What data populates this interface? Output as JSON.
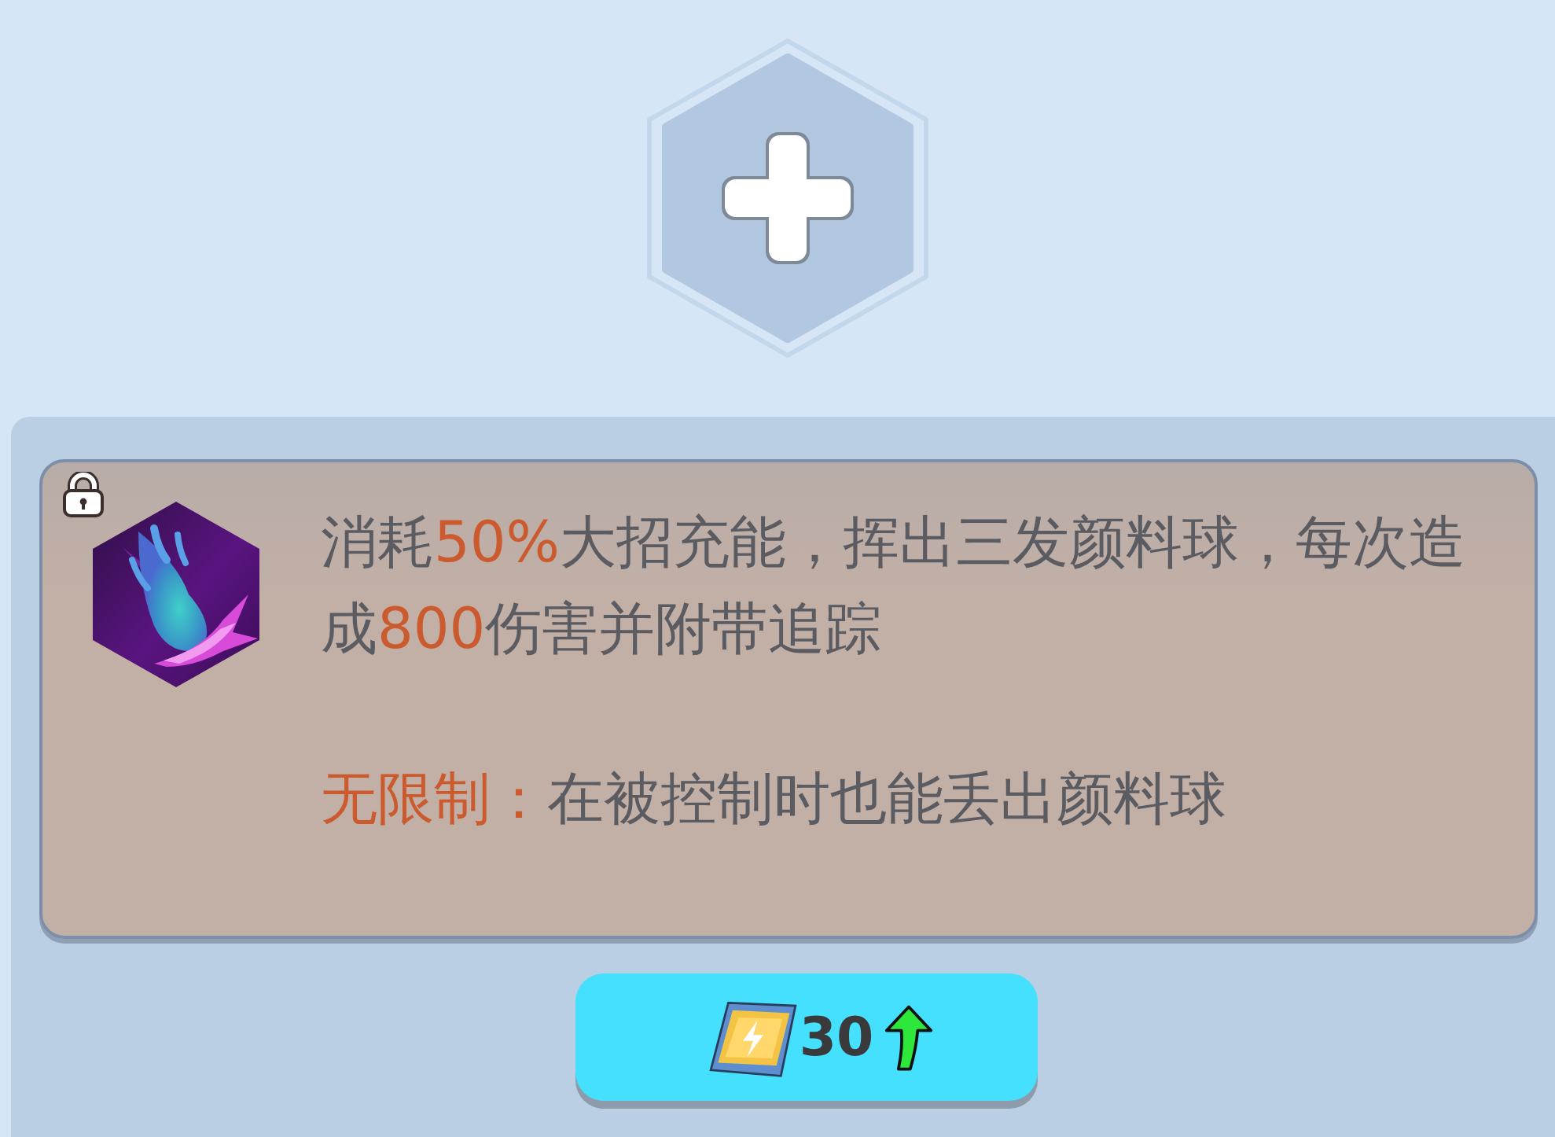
{
  "skill_slot": {
    "empty": true
  },
  "skill_card": {
    "locked": true,
    "description": [
      {
        "text": "消耗",
        "highlight": false
      },
      {
        "text": "50%",
        "highlight": true
      },
      {
        "text": "大招充能，挥出三发颜料球，每次造成",
        "highlight": false
      },
      {
        "text": "800",
        "highlight": true
      },
      {
        "text": "伤害并附带追踪",
        "highlight": false
      }
    ],
    "effect": {
      "label": "无限制：",
      "text": "在被控制时也能丢出颜料球"
    }
  },
  "upgrade_button": {
    "cost": "30",
    "upgradeable": true
  }
}
